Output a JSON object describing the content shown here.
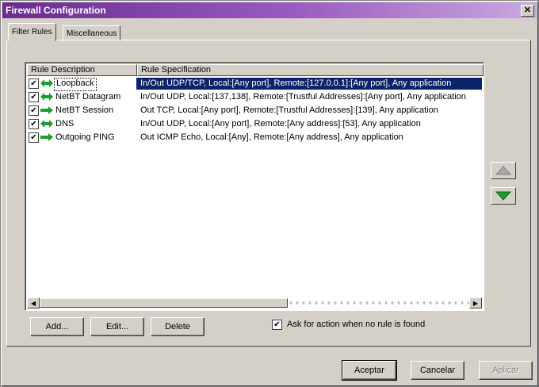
{
  "window": {
    "title": "Firewall Configuration",
    "close_label": "✕"
  },
  "tabs": [
    {
      "label": "Filter Rules",
      "active": true
    },
    {
      "label": "Miscellaneous",
      "active": false
    }
  ],
  "list": {
    "columns": [
      "Rule Description",
      "Rule Specification"
    ],
    "rows": [
      {
        "checked": "✔",
        "icon": "bidirectional-arrow-icon",
        "description": "Loopback",
        "specification": "In/Out UDP/TCP, Local:[Any port], Remote:[127.0.0.1]:[Any port], Any application",
        "selected": true
      },
      {
        "checked": "✔",
        "icon": "bidirectional-arrow-icon",
        "description": "NetBT Datagram",
        "specification": "In/Out UDP, Local:[137,138], Remote:[Trustful Addresses]:[Any port], Any application",
        "selected": false
      },
      {
        "checked": "✔",
        "icon": "outgoing-arrow-icon",
        "description": "NetBT Session",
        "specification": "Out TCP, Local:[Any port], Remote:[Trustful Addresses]:[139], Any application",
        "selected": false
      },
      {
        "checked": "✔",
        "icon": "bidirectional-arrow-icon",
        "description": "DNS",
        "specification": "In/Out UDP, Local:[Any port], Remote:[Any address]:[53], Any application",
        "selected": false
      },
      {
        "checked": "✔",
        "icon": "outgoing-arrow-icon",
        "description": "Outgoing PING",
        "specification": "Out ICMP Echo, Local:[Any], Remote:[Any address], Any application",
        "selected": false
      }
    ],
    "scroll_left_label": "◀",
    "scroll_right_label": "▶"
  },
  "buttons": {
    "add": "Add...",
    "edit": "Edit...",
    "delete": "Delete",
    "accept": "Aceptar",
    "cancel": "Cancelar",
    "apply": "Aplicar"
  },
  "options": {
    "ask_for_action": {
      "checked": "✔",
      "label": "Ask for action when no rule is found"
    }
  },
  "colors": {
    "selection": "#0a246a",
    "arrow_green": "#1e9b2a",
    "title_bar": "#6a2c8e"
  }
}
